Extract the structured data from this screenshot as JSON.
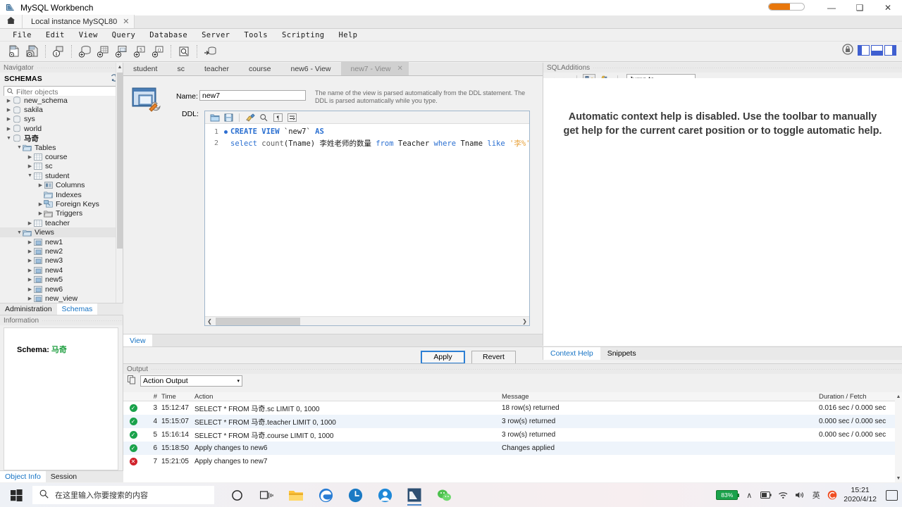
{
  "window": {
    "title": "MySQL Workbench",
    "minimize": "—",
    "maximize": "❑",
    "close": "✕"
  },
  "app_tabs": {
    "home_icon": "home-icon",
    "instance_tab": "Local instance MySQL80",
    "close_glyph": "✕"
  },
  "menu": [
    "File",
    "Edit",
    "View",
    "Query",
    "Database",
    "Server",
    "Tools",
    "Scripting",
    "Help"
  ],
  "toolbar": {
    "items": [
      "new-sql-tab-icon",
      "open-sql-script-icon",
      "open-connection-info-icon",
      "new-schema-icon",
      "new-table-icon",
      "new-view-icon",
      "new-procedure-icon",
      "new-function-icon",
      "search-data-icon",
      "reconnect-dbms-icon"
    ],
    "lock_icon": "lock-icon",
    "panel_toggles": [
      "sidebar-toggle",
      "output-panel-toggle",
      "secondary-sidebar-toggle"
    ]
  },
  "navigator": {
    "title": "Navigator",
    "schemas_label": "SCHEMAS",
    "refresh_icon": "refresh-icon",
    "filter_placeholder": "Filter objects",
    "search_icon": "search-icon",
    "tree": [
      {
        "label": "new_schema",
        "icon": "schema-icon",
        "indent": 0,
        "arrow": "▶",
        "bold": false
      },
      {
        "label": "sakila",
        "icon": "schema-icon",
        "indent": 0,
        "arrow": "▶",
        "bold": false
      },
      {
        "label": "sys",
        "icon": "schema-icon",
        "indent": 0,
        "arrow": "▶",
        "bold": false
      },
      {
        "label": "world",
        "icon": "schema-icon",
        "indent": 0,
        "arrow": "▶",
        "bold": false
      },
      {
        "label": "马奇",
        "icon": "schema-icon",
        "indent": 0,
        "arrow": "▼",
        "bold": true
      },
      {
        "label": "Tables",
        "icon": "folder-icon",
        "indent": 1,
        "arrow": "▼",
        "bold": false
      },
      {
        "label": "course",
        "icon": "table-icon",
        "indent": 2,
        "arrow": "▶",
        "bold": false
      },
      {
        "label": "sc",
        "icon": "table-icon",
        "indent": 2,
        "arrow": "▶",
        "bold": false
      },
      {
        "label": "student",
        "icon": "table-icon",
        "indent": 2,
        "arrow": "▼",
        "bold": false
      },
      {
        "label": "Columns",
        "icon": "columns-icon",
        "indent": 3,
        "arrow": "▶",
        "bold": false
      },
      {
        "label": "Indexes",
        "icon": "indexes-icon",
        "indent": 3,
        "arrow": "",
        "bold": false
      },
      {
        "label": "Foreign Keys",
        "icon": "foreign-keys-icon",
        "indent": 3,
        "arrow": "▶",
        "bold": false
      },
      {
        "label": "Triggers",
        "icon": "triggers-icon",
        "indent": 3,
        "arrow": "▶",
        "bold": false
      },
      {
        "label": "teacher",
        "icon": "table-icon",
        "indent": 2,
        "arrow": "▶",
        "bold": false
      },
      {
        "label": "Views",
        "icon": "folder-icon",
        "indent": 1,
        "arrow": "▼",
        "bold": false,
        "selected": true
      },
      {
        "label": "new1",
        "icon": "view-icon",
        "indent": 2,
        "arrow": "▶",
        "bold": false
      },
      {
        "label": "new2",
        "icon": "view-icon",
        "indent": 2,
        "arrow": "▶",
        "bold": false
      },
      {
        "label": "new3",
        "icon": "view-icon",
        "indent": 2,
        "arrow": "▶",
        "bold": false
      },
      {
        "label": "new4",
        "icon": "view-icon",
        "indent": 2,
        "arrow": "▶",
        "bold": false
      },
      {
        "label": "new5",
        "icon": "view-icon",
        "indent": 2,
        "arrow": "▶",
        "bold": false
      },
      {
        "label": "new6",
        "icon": "view-icon",
        "indent": 2,
        "arrow": "▶",
        "bold": false
      },
      {
        "label": "new_view",
        "icon": "view-icon",
        "indent": 2,
        "arrow": "▶",
        "bold": false
      }
    ],
    "tabs": [
      {
        "label": "Administration",
        "active": false
      },
      {
        "label": "Schemas",
        "active": true
      }
    ]
  },
  "information": {
    "title": "Information",
    "schema_label": "Schema:",
    "schema_name": "马奇",
    "tabs": [
      {
        "label": "Object Info",
        "active": true
      },
      {
        "label": "Session",
        "active": false
      }
    ]
  },
  "editor": {
    "tabs": [
      {
        "label": "student",
        "active": false
      },
      {
        "label": "sc",
        "active": false
      },
      {
        "label": "teacher",
        "active": false
      },
      {
        "label": "course",
        "active": false
      },
      {
        "label": "new6 - View",
        "active": false
      },
      {
        "label": "new7 - View",
        "active": true
      }
    ],
    "view_icon": "view-editor-icon",
    "name_label": "Name:",
    "name_value": "new7",
    "ddl_label": "DDL:",
    "hint": "The name of the view is parsed automatically from the DDL statement. The DDL is parsed automatically while you type.",
    "ddl_toolbar": [
      "open-file-icon",
      "save-file-icon",
      "beautify-icon",
      "find-icon",
      "pilcrow-icon",
      "wrap-lines-icon"
    ],
    "code_lines": [
      {
        "num": "1",
        "marked": true,
        "tokens": [
          {
            "t": "CREATE",
            "c": "kw"
          },
          {
            "t": " ",
            "c": "id"
          },
          {
            "t": "VIEW",
            "c": "kw"
          },
          {
            "t": " ",
            "c": "id"
          },
          {
            "t": "`new7`",
            "c": "id"
          },
          {
            "t": " ",
            "c": "id"
          },
          {
            "t": "AS",
            "c": "kw"
          }
        ]
      },
      {
        "num": "2",
        "marked": false,
        "tokens": [
          {
            "t": "select",
            "c": "kw2"
          },
          {
            "t": " ",
            "c": "id"
          },
          {
            "t": "count",
            "c": "fn"
          },
          {
            "t": "(Tname) ",
            "c": "id"
          },
          {
            "t": "李姓老师的数量",
            "c": "cn"
          },
          {
            "t": " ",
            "c": "id"
          },
          {
            "t": "from",
            "c": "kw2"
          },
          {
            "t": " ",
            "c": "id"
          },
          {
            "t": "Teacher",
            "c": "id"
          },
          {
            "t": " ",
            "c": "id"
          },
          {
            "t": "where",
            "c": "kw2"
          },
          {
            "t": " ",
            "c": "id"
          },
          {
            "t": "Tname",
            "c": "id"
          },
          {
            "t": " ",
            "c": "id"
          },
          {
            "t": "like",
            "c": "kw2"
          },
          {
            "t": " ",
            "c": "id"
          },
          {
            "t": "'李%'",
            "c": "str"
          }
        ]
      }
    ],
    "bottom_tabs": [
      {
        "label": "View",
        "active": true
      }
    ],
    "apply_label": "Apply",
    "revert_label": "Revert"
  },
  "sql_additions": {
    "title": "SQLAdditions",
    "back_glyph": "◄",
    "forward_glyph": "►",
    "help_icons": [
      "context-help-icon",
      "auto-help-toggle-icon"
    ],
    "jump_to": "Jump to",
    "chevron": "▾",
    "message": "Automatic context help is disabled. Use the toolbar to manually get help for the current caret position or to toggle automatic help.",
    "tabs": [
      {
        "label": "Context Help",
        "active": true
      },
      {
        "label": "Snippets",
        "active": false
      }
    ]
  },
  "output": {
    "title": "Output",
    "copy_icon": "copy-icon",
    "selected_filter": "Action Output",
    "chevron": "▾",
    "columns": [
      "#",
      "Time",
      "Action",
      "Message",
      "Duration / Fetch"
    ],
    "rows": [
      {
        "status": "ok",
        "num": "3",
        "time": "15:12:47",
        "action": "SELECT * FROM 马奇.sc LIMIT 0, 1000",
        "message": "18 row(s) returned",
        "duration": "0.016 sec / 0.000 sec"
      },
      {
        "status": "ok",
        "num": "4",
        "time": "15:15:07",
        "action": "SELECT * FROM 马奇.teacher LIMIT 0, 1000",
        "message": "3 row(s) returned",
        "duration": "0.000 sec / 0.000 sec"
      },
      {
        "status": "ok",
        "num": "5",
        "time": "15:16:14",
        "action": "SELECT * FROM 马奇.course LIMIT 0, 1000",
        "message": "3 row(s) returned",
        "duration": "0.000 sec / 0.000 sec"
      },
      {
        "status": "ok",
        "num": "6",
        "time": "15:18:50",
        "action": "Apply changes to new6",
        "message": "Changes applied",
        "duration": ""
      },
      {
        "status": "err",
        "num": "7",
        "time": "15:21:05",
        "action": "Apply changes to new7",
        "message": "",
        "duration": ""
      }
    ]
  },
  "taskbar": {
    "start_icon": "windows-start-icon",
    "search_placeholder": "在这里输入你要搜索的内容",
    "search_icon": "search-icon",
    "pinned": [
      "cortana-icon",
      "task-view-icon",
      "file-explorer-icon",
      "edge-icon",
      "clock-app-icon",
      "mail-icon",
      "mysql-workbench-icon",
      "wechat-icon"
    ],
    "tray": {
      "battery_percent": "83%",
      "chevron_up": "∧",
      "icons": [
        "battery-icon",
        "wifi-icon",
        "volume-icon",
        "ime-icon",
        "sogou-icon"
      ],
      "time": "15:21",
      "date": "2020/4/12",
      "action_center_icon": "action-center-icon"
    }
  },
  "colors": {
    "accent_blue": "#1673c4",
    "ok_green": "#1aa24b",
    "err_red": "#d0202a",
    "keyword_blue": "#2a6fd1",
    "string_orange": "#e8a33d",
    "schema_green": "#1d9e3f"
  }
}
